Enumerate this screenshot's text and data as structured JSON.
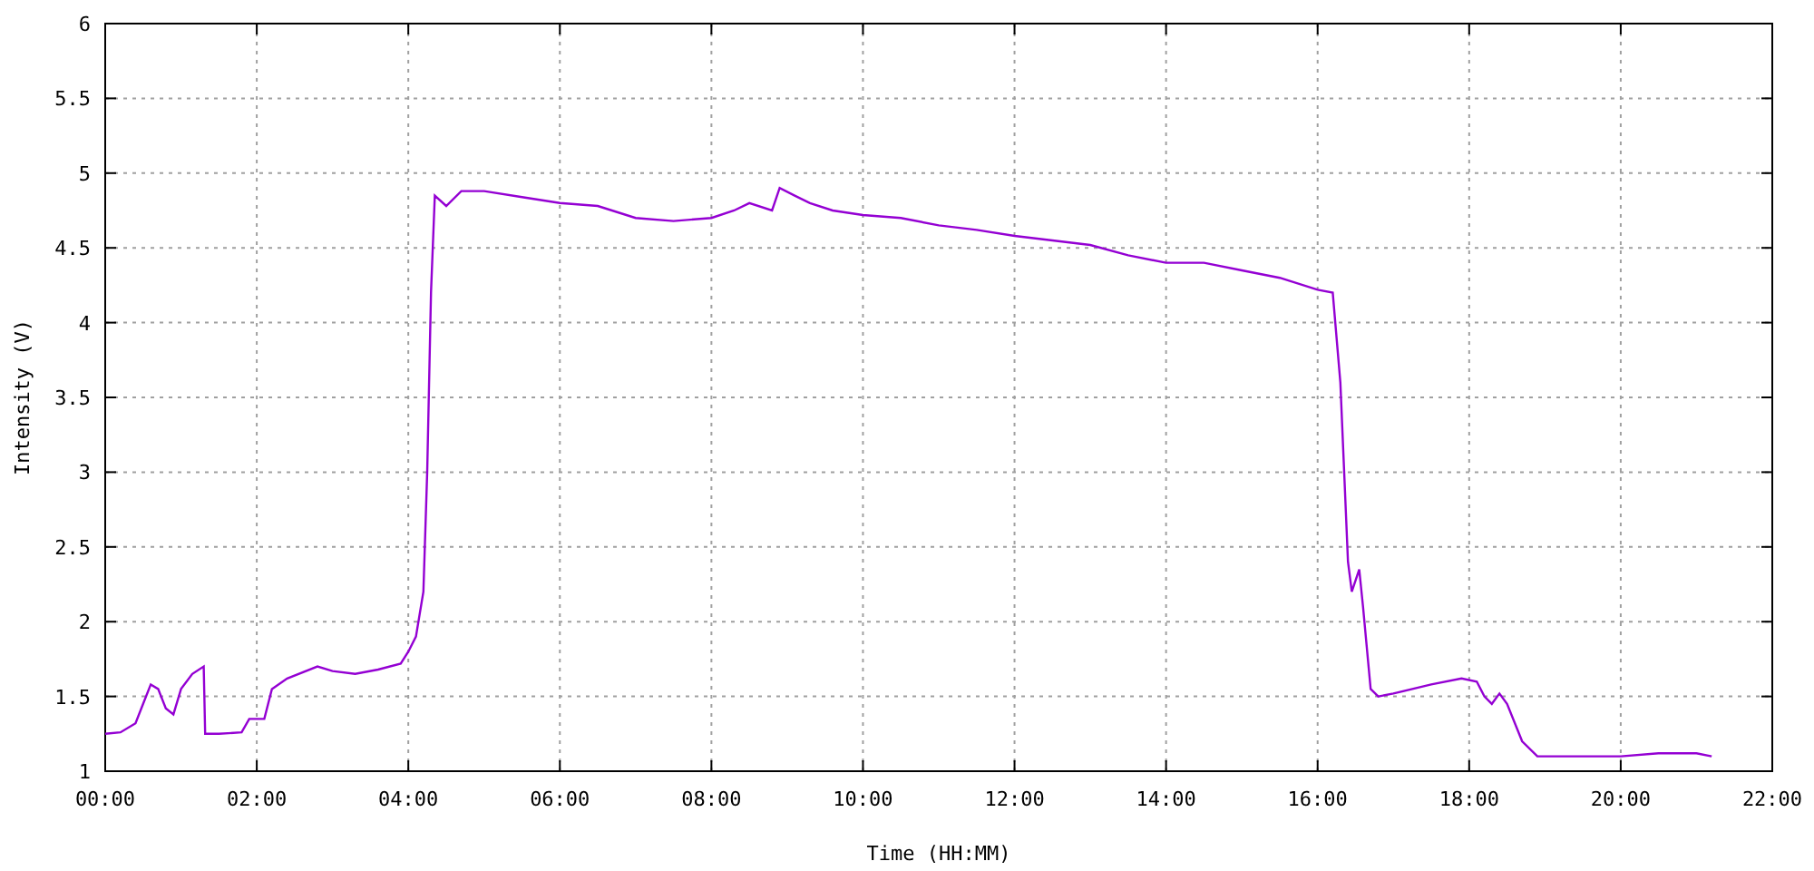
{
  "chart": {
    "chart_data": {
      "type": "line",
      "xlabel": "Time (HH:MM)",
      "ylabel": "Intensity (V)",
      "x": [
        0,
        0.2,
        0.4,
        0.5,
        0.6,
        0.7,
        0.8,
        0.9,
        1.0,
        1.15,
        1.3,
        1.32,
        1.5,
        1.8,
        1.9,
        2.1,
        2.2,
        2.4,
        2.8,
        3.0,
        3.3,
        3.6,
        3.9,
        4.0,
        4.1,
        4.2,
        4.25,
        4.3,
        4.35,
        4.5,
        4.7,
        5.0,
        5.5,
        6.0,
        6.5,
        7.0,
        7.5,
        8.0,
        8.3,
        8.5,
        8.8,
        8.9,
        9.1,
        9.3,
        9.6,
        10.0,
        10.5,
        11.0,
        11.5,
        12.0,
        12.5,
        13.0,
        13.5,
        14.0,
        14.5,
        15.0,
        15.5,
        16.0,
        16.2,
        16.3,
        16.4,
        16.45,
        16.55,
        16.6,
        16.7,
        16.8,
        17.0,
        17.5,
        17.9,
        18.1,
        18.2,
        18.3,
        18.4,
        18.5,
        18.7,
        18.9,
        19.5,
        20.0,
        20.5,
        21.0,
        21.2
      ],
      "series": [
        {
          "color": "#9400d3",
          "values": [
            1.25,
            1.26,
            1.32,
            1.45,
            1.58,
            1.55,
            1.42,
            1.38,
            1.55,
            1.65,
            1.7,
            1.25,
            1.25,
            1.26,
            1.35,
            1.35,
            1.55,
            1.62,
            1.7,
            1.67,
            1.65,
            1.68,
            1.72,
            1.8,
            1.9,
            2.2,
            3.0,
            4.2,
            4.85,
            4.78,
            4.88,
            4.88,
            4.84,
            4.8,
            4.78,
            4.7,
            4.68,
            4.7,
            4.75,
            4.8,
            4.75,
            4.9,
            4.85,
            4.8,
            4.75,
            4.72,
            4.7,
            4.65,
            4.62,
            4.58,
            4.55,
            4.52,
            4.45,
            4.4,
            4.4,
            4.35,
            4.3,
            4.22,
            4.2,
            3.6,
            2.4,
            2.2,
            2.35,
            2.1,
            1.55,
            1.5,
            1.52,
            1.58,
            1.62,
            1.6,
            1.5,
            1.45,
            1.52,
            1.45,
            1.2,
            1.1,
            1.1,
            1.1,
            1.12,
            1.12,
            1.1
          ]
        }
      ],
      "xlim": [
        0,
        22
      ],
      "ylim": [
        1,
        6
      ],
      "xticks": [
        {
          "value": 0,
          "label": "00:00"
        },
        {
          "value": 2,
          "label": "02:00"
        },
        {
          "value": 4,
          "label": "04:00"
        },
        {
          "value": 6,
          "label": "06:00"
        },
        {
          "value": 8,
          "label": "08:00"
        },
        {
          "value": 10,
          "label": "10:00"
        },
        {
          "value": 12,
          "label": "12:00"
        },
        {
          "value": 14,
          "label": "14:00"
        },
        {
          "value": 16,
          "label": "16:00"
        },
        {
          "value": 18,
          "label": "18:00"
        },
        {
          "value": 20,
          "label": "20:00"
        },
        {
          "value": 22,
          "label": "22:00"
        }
      ],
      "grid": true,
      "yticks": [
        1,
        1.5,
        2,
        2.5,
        3,
        3.5,
        4,
        4.5,
        5,
        5.5,
        6
      ]
    }
  }
}
